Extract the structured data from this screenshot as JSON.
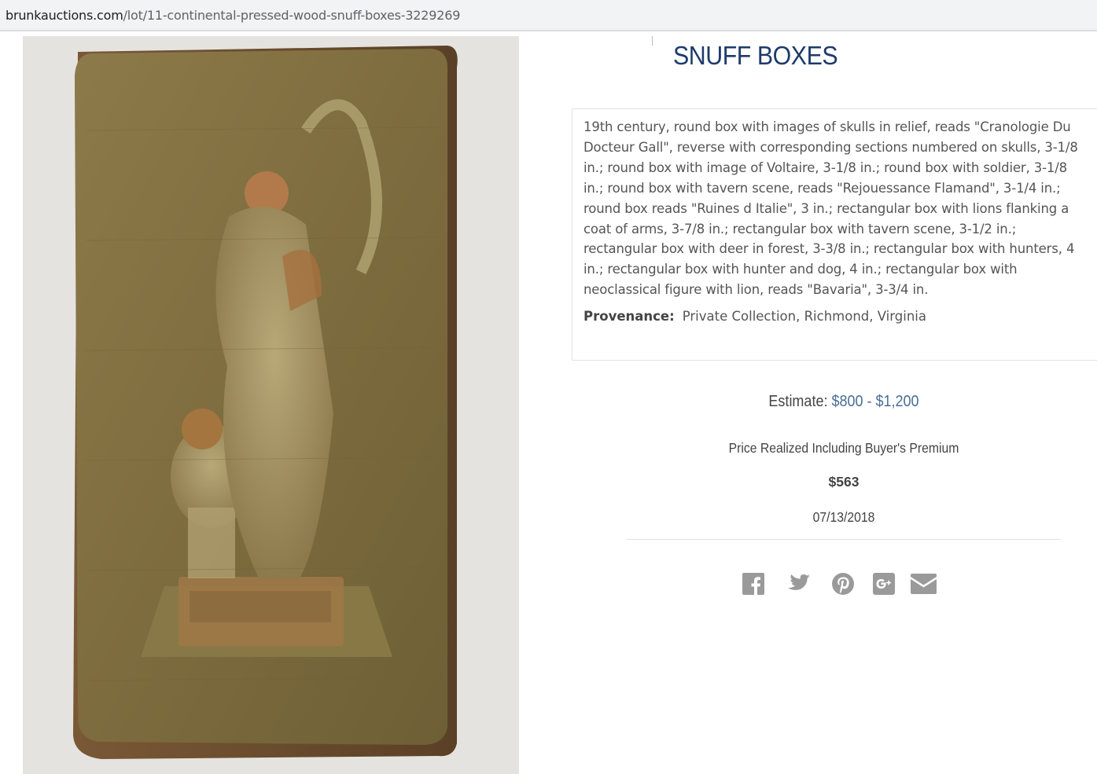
{
  "browser": {
    "url_host": "brunkauctions.com",
    "url_path": "/lot/11-continental-pressed-wood-snuff-boxes-3229269"
  },
  "lot": {
    "title": "SNUFF BOXES",
    "description": "19th century, round box with images of skulls in relief, reads \"Cranologie Du Docteur Gall\", reverse with corresponding sections numbered on skulls, 3-1/8 in.; round box with image of Voltaire, 3-1/8 in.; round box with soldier, 3-1/8 in.; round box with tavern scene, reads \"Rejouessance Flamand\", 3-1/4 in.; round box reads \"Ruines d Italie\", 3 in.; rectangular box with lions flanking a coat of arms, 3-7/8 in.; rectangular box with tavern scene, 3-1/2 in.; rectangular box with deer in forest, 3-3/8 in.; rectangular box with hunters, 4 in.; rectangular box with hunter and dog, 4 in.; rectangular box with neoclassical figure with lion, reads \"Bavaria\", 3-3/4 in.",
    "provenance_label": "Provenance:",
    "provenance_value": "Private Collection, Richmond, Virginia",
    "estimate_label": "Estimate:",
    "estimate_value": "$800 - $1,200",
    "realized_label": "Price Realized Including Buyer's Premium",
    "realized_value": "$563",
    "sale_date": "07/13/2018"
  },
  "share_icons": [
    "facebook-icon",
    "twitter-icon",
    "pinterest-icon",
    "google-plus-icon",
    "email-icon"
  ],
  "colors": {
    "title": "#1d3a6b",
    "estimate_value": "#4a6e95",
    "text": "#555555",
    "icon": "#9a9a9a"
  }
}
